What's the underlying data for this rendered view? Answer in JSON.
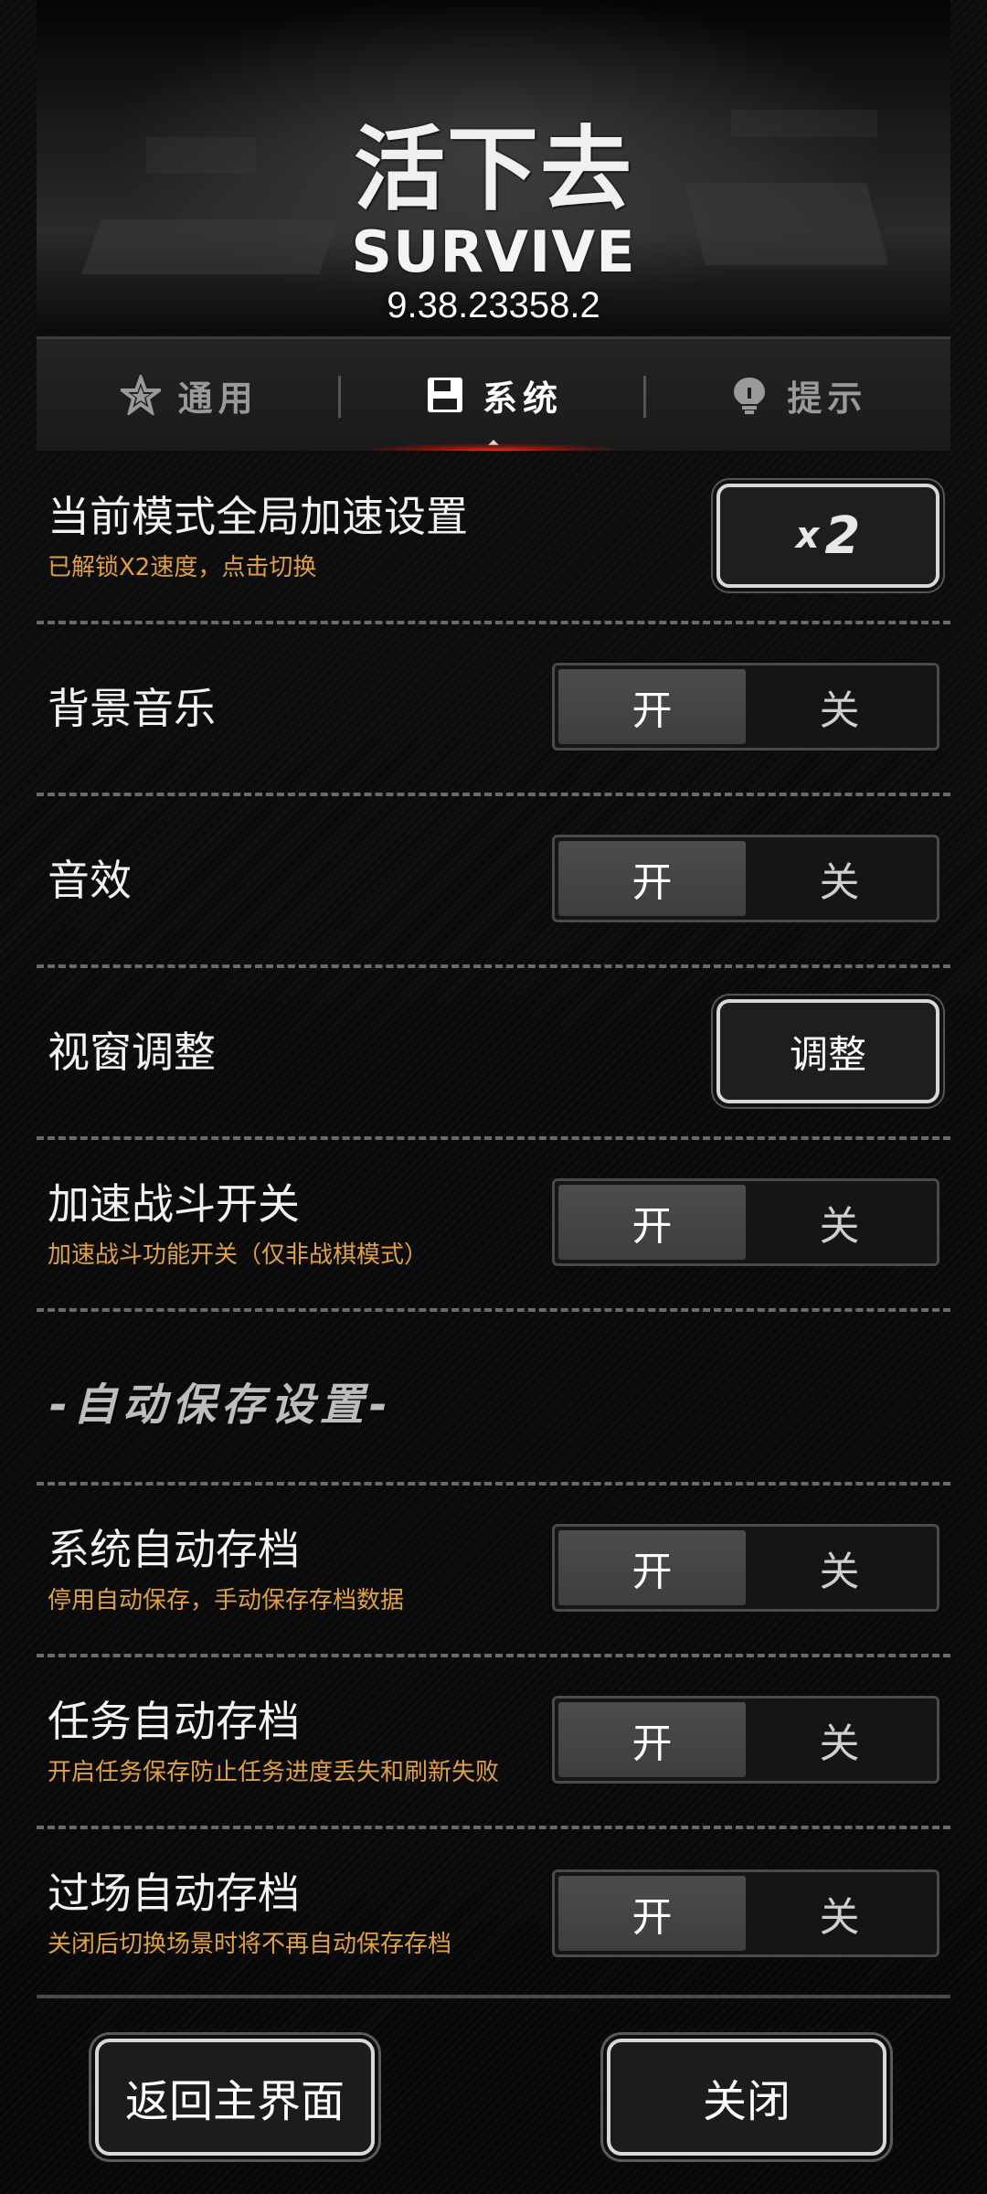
{
  "header": {
    "logo_cn": "活下去",
    "logo_en": "SURVIVE",
    "version": "9.38.23358.2"
  },
  "tabs": [
    {
      "label": "通用",
      "icon": "star-icon",
      "active": false
    },
    {
      "label": "系统",
      "icon": "floppy-disk-icon",
      "active": true
    },
    {
      "label": "提示",
      "icon": "lightbulb-icon",
      "active": false
    }
  ],
  "settings": {
    "speed": {
      "title": "当前模式全局加速设置",
      "subtitle": "已解锁X2速度，点击切换",
      "x": "x",
      "value": "2"
    },
    "music": {
      "title": "背景音乐",
      "on": "开",
      "off": "关"
    },
    "sfx": {
      "title": "音效",
      "on": "开",
      "off": "关"
    },
    "viewport": {
      "title": "视窗调整",
      "button": "调整"
    },
    "fast_battle": {
      "title": "加速战斗开关",
      "subtitle": "加速战斗功能开关（仅非战棋模式）",
      "on": "开",
      "off": "关"
    },
    "autosave_section": "-自动保存设置-",
    "system_autosave": {
      "title": "系统自动存档",
      "subtitle": "停用自动保存，手动保存存档数据",
      "on": "开",
      "off": "关"
    },
    "task_autosave": {
      "title": "任务自动存档",
      "subtitle": "开启任务保存防止任务进度丢失和刷新失败",
      "on": "开",
      "off": "关"
    },
    "cutscene_autosave": {
      "title": "过场自动存档",
      "subtitle": "关闭后切换场景时将不再自动保存存档",
      "on": "开",
      "off": "关"
    }
  },
  "footer": {
    "back": "返回主界面",
    "close": "关闭"
  },
  "colors": {
    "accent_orange": "#e0a048",
    "tab_glow": "#e0301f"
  }
}
